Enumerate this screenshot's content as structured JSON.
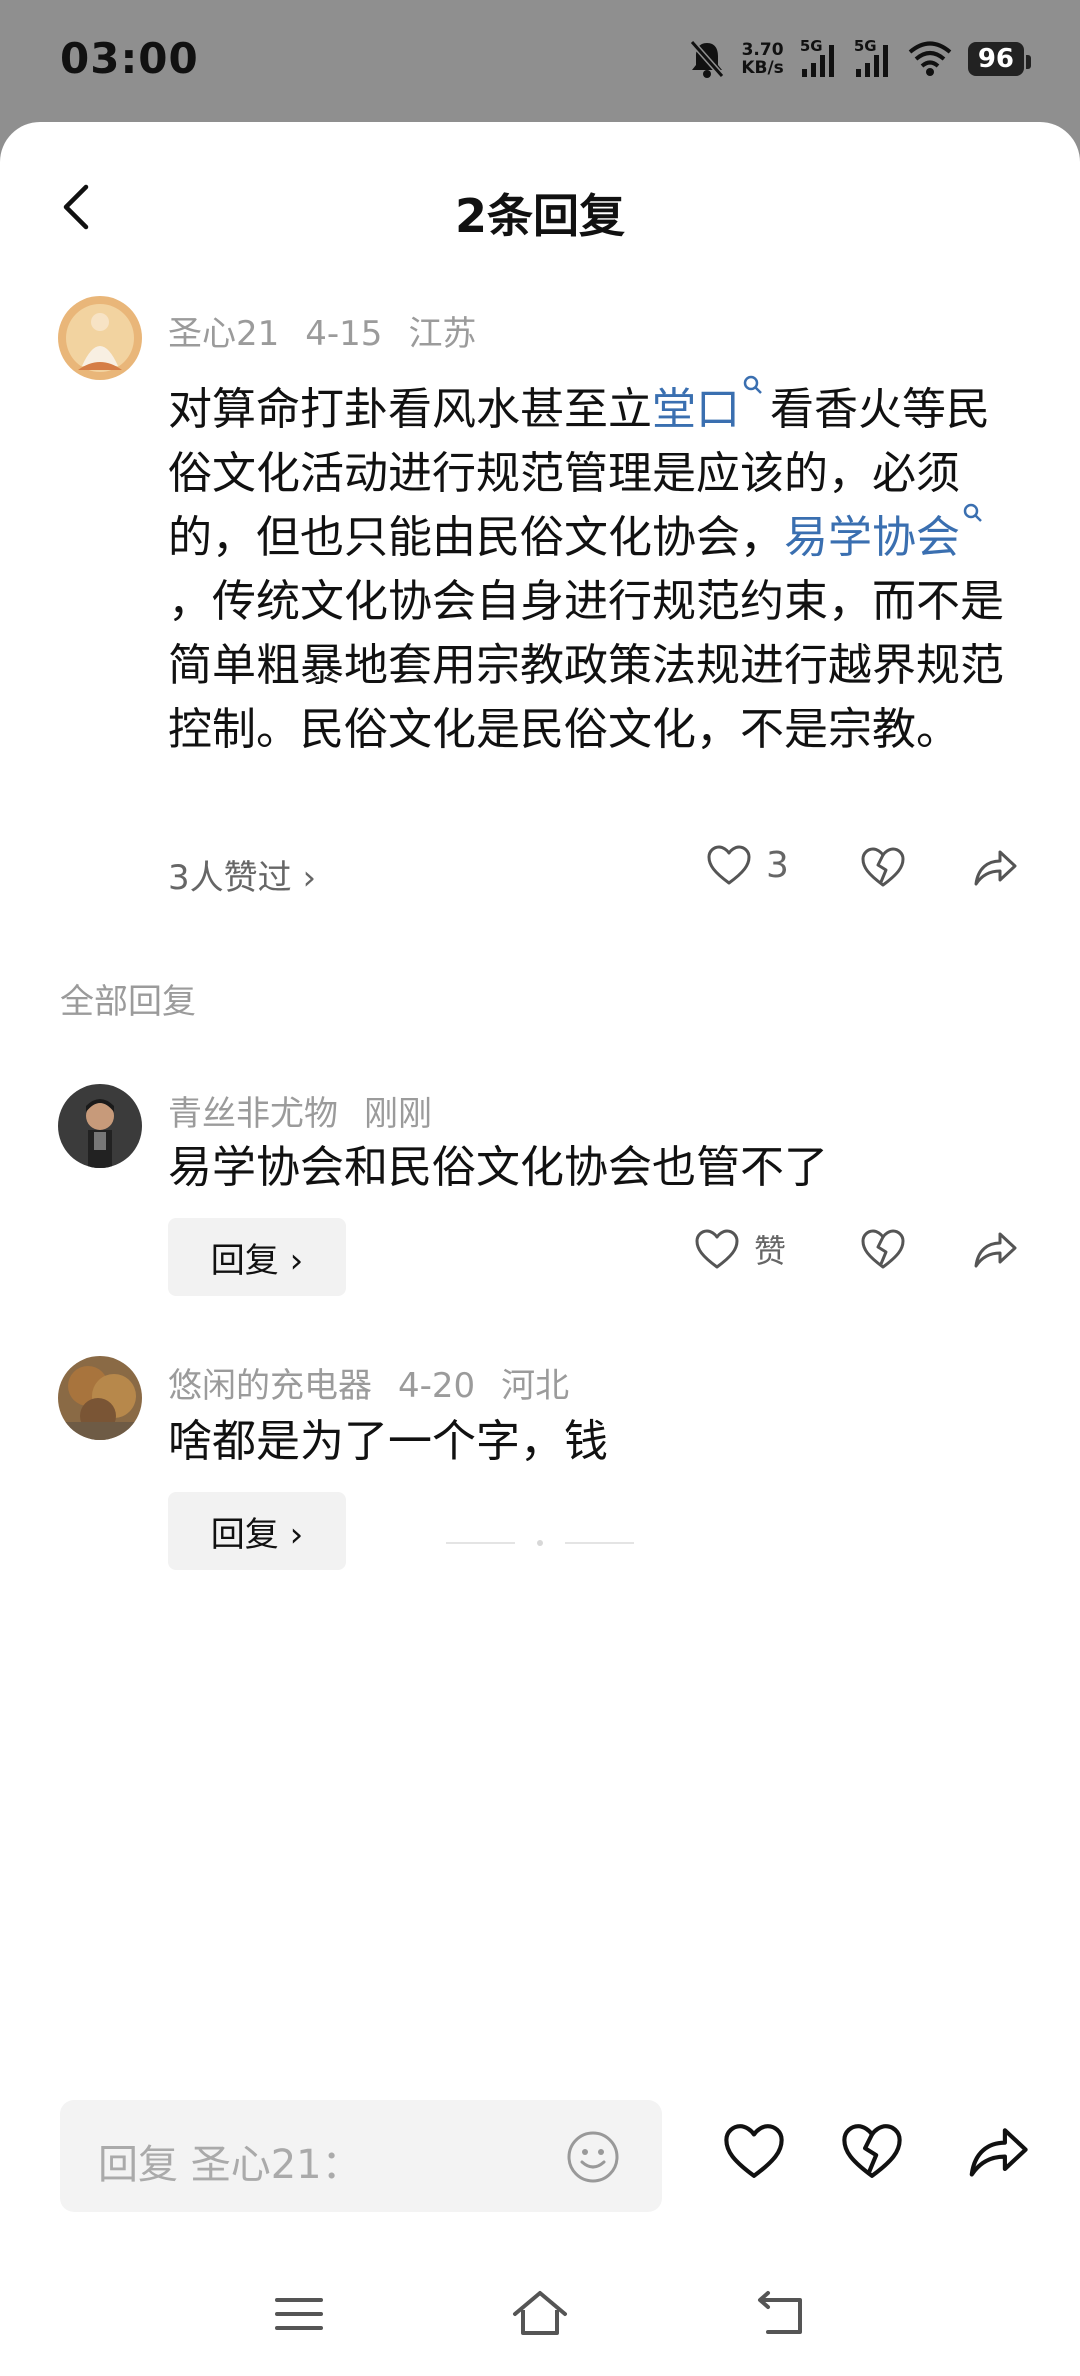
{
  "status_bar": {
    "time": "03:00",
    "speed_value": "3.70",
    "speed_unit": "KB/s",
    "sim1": "5G",
    "sim2": "5G",
    "battery": "96"
  },
  "header": {
    "title": "2条回复"
  },
  "main_comment": {
    "author": "圣心21",
    "date": "4-15",
    "location": "江苏",
    "text_part1": "对算命打卦看风水甚至立",
    "link1": "堂口",
    "text_part2": "看香火等民俗文化活动进行规范管理是应该的，必须的，但也只能由民俗文化协会，",
    "link2": "易学协会",
    "text_part3": "，传统文化协会自身进行规范约束，而不是简单粗暴地套用宗教政策法规进行越界规范控制。民俗文化是民俗文化，不是宗教。",
    "likes_summary": "3人赞过 ›",
    "like_count": "3"
  },
  "section_title": "全部回复",
  "replies": [
    {
      "author": "青丝非尤物",
      "time": "刚刚",
      "text": "易学协会和民俗文化协会也管不了",
      "reply_label": "回复 ›",
      "like_label": "赞"
    },
    {
      "author": "悠闲的充电器",
      "date": "4-20",
      "location": "河北",
      "text": "啥都是为了一个字，钱",
      "reply_label": "回复 ›"
    }
  ],
  "bottom_bar": {
    "placeholder": "回复 圣心21："
  },
  "icons": {
    "back": "chevron-left-icon",
    "like": "heart-outline-icon",
    "dislike": "broken-heart-icon",
    "share": "share-arrow-icon",
    "emoji": "smiley-icon",
    "nav_menu": "menu-lines-icon",
    "nav_home": "home-icon",
    "nav_back": "return-icon"
  },
  "colors": {
    "link": "#3a6fb0",
    "muted": "#9b9b9b",
    "statusbar_bg": "#8f8f8f"
  }
}
